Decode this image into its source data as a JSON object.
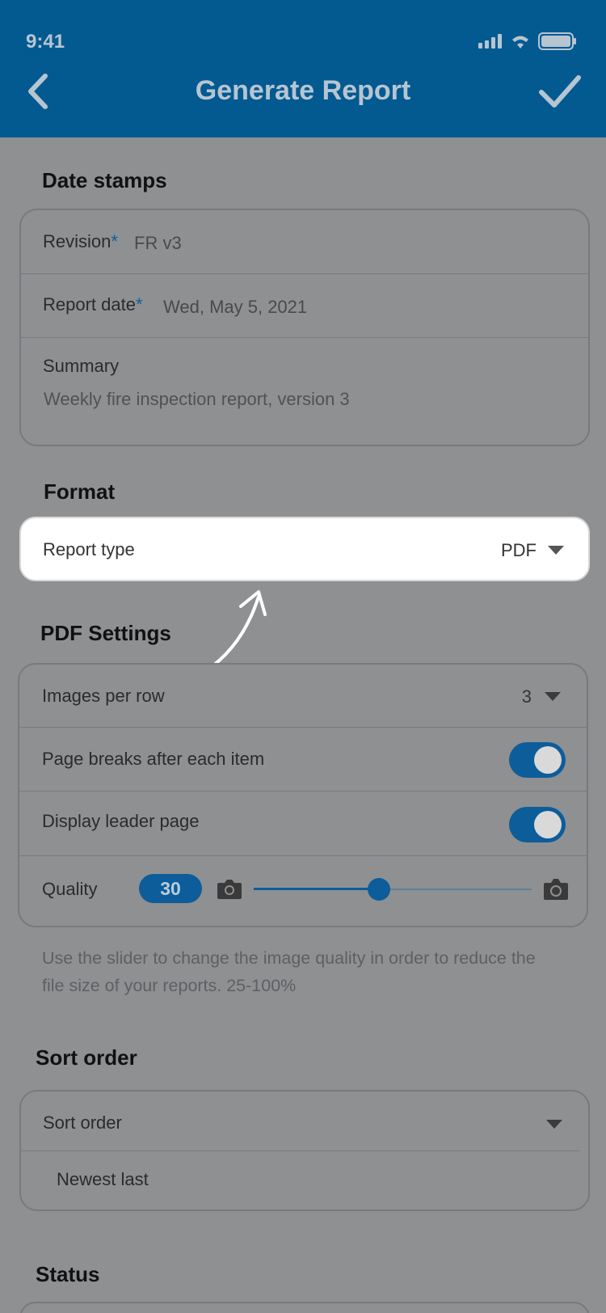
{
  "status_bar": {
    "time": "9:41"
  },
  "header": {
    "title": "Generate Report"
  },
  "date_stamps": {
    "title": "Date stamps",
    "revision_label": "Revision",
    "revision_value": "FR v3",
    "report_date_label": "Report date",
    "report_date_value": "Wed, May 5, 2021",
    "summary_label": "Summary",
    "summary_value": "Weekly fire inspection report, version 3",
    "required_mark": "*"
  },
  "format": {
    "title": "Format",
    "report_type_label": "Report type",
    "report_type_value": "PDF"
  },
  "pdf_settings": {
    "title": "PDF Settings",
    "images_per_row_label": "Images per row",
    "images_per_row_value": "3",
    "page_breaks_label": "Page breaks after each item",
    "page_breaks_on": true,
    "leader_page_label": "Display leader page",
    "leader_page_on": true,
    "quality_label": "Quality",
    "quality_value": "30",
    "quality_slider_fraction": 0.45,
    "help_text": "Use the slider to change the image quality in order to reduce the file size of your reports. 25-100%"
  },
  "sort": {
    "title": "Sort order",
    "dropdown_label": "Sort order",
    "selected": "Newest last"
  },
  "status": {
    "title": "Status"
  },
  "colors": {
    "header": "#025a91",
    "accent": "#0c5d9a",
    "overlay_bg": "#8f9092"
  }
}
